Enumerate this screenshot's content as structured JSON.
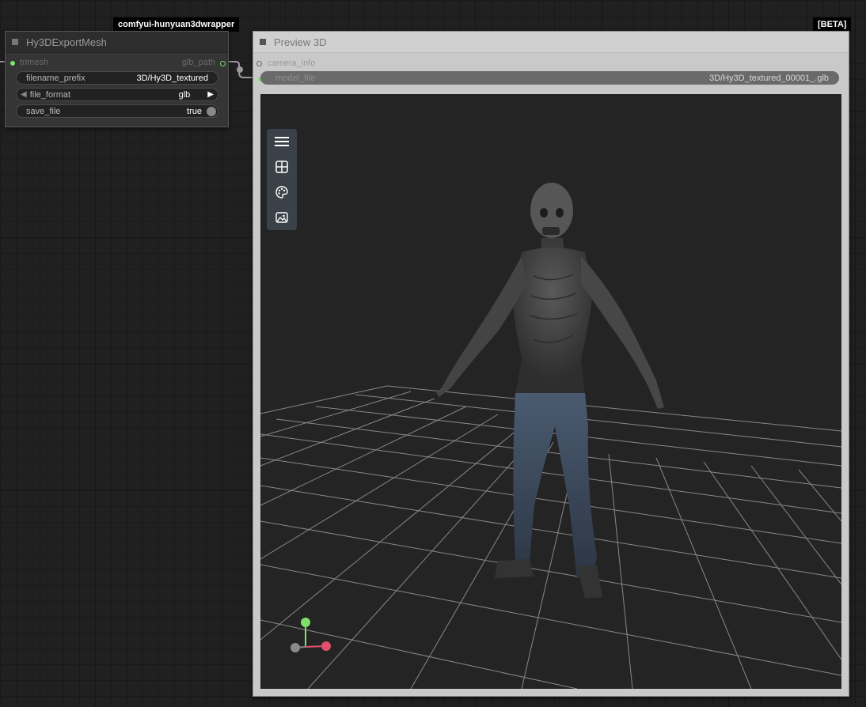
{
  "badges": {
    "left": "comfyui-hunyuan3dwrapper",
    "right": "[BETA]"
  },
  "export_node": {
    "title": "Hy3DExportMesh",
    "input_slot": "trimesh",
    "output_slot": "glb_path",
    "widgets": {
      "filename_prefix": {
        "label": "filename_prefix",
        "value": "3D/Hy3D_textured"
      },
      "file_format": {
        "label": "file_format",
        "value": "glb"
      },
      "save_file": {
        "label": "save_file",
        "value": "true"
      }
    }
  },
  "preview_node": {
    "title": "Preview 3D",
    "slots": {
      "camera_info": "camera_info",
      "model_file": "model_file"
    },
    "model_file_value": "3D/Hy3D_textured_00001_.glb",
    "toolbar_icons": [
      "menu-icon",
      "grid-layout-icon",
      "palette-icon",
      "image-icon"
    ]
  },
  "colors": {
    "slot_green": "#7de36e",
    "axis_x": "#e0506a",
    "axis_y": "#7fe06a",
    "axis_z": "#8a8a8a"
  }
}
